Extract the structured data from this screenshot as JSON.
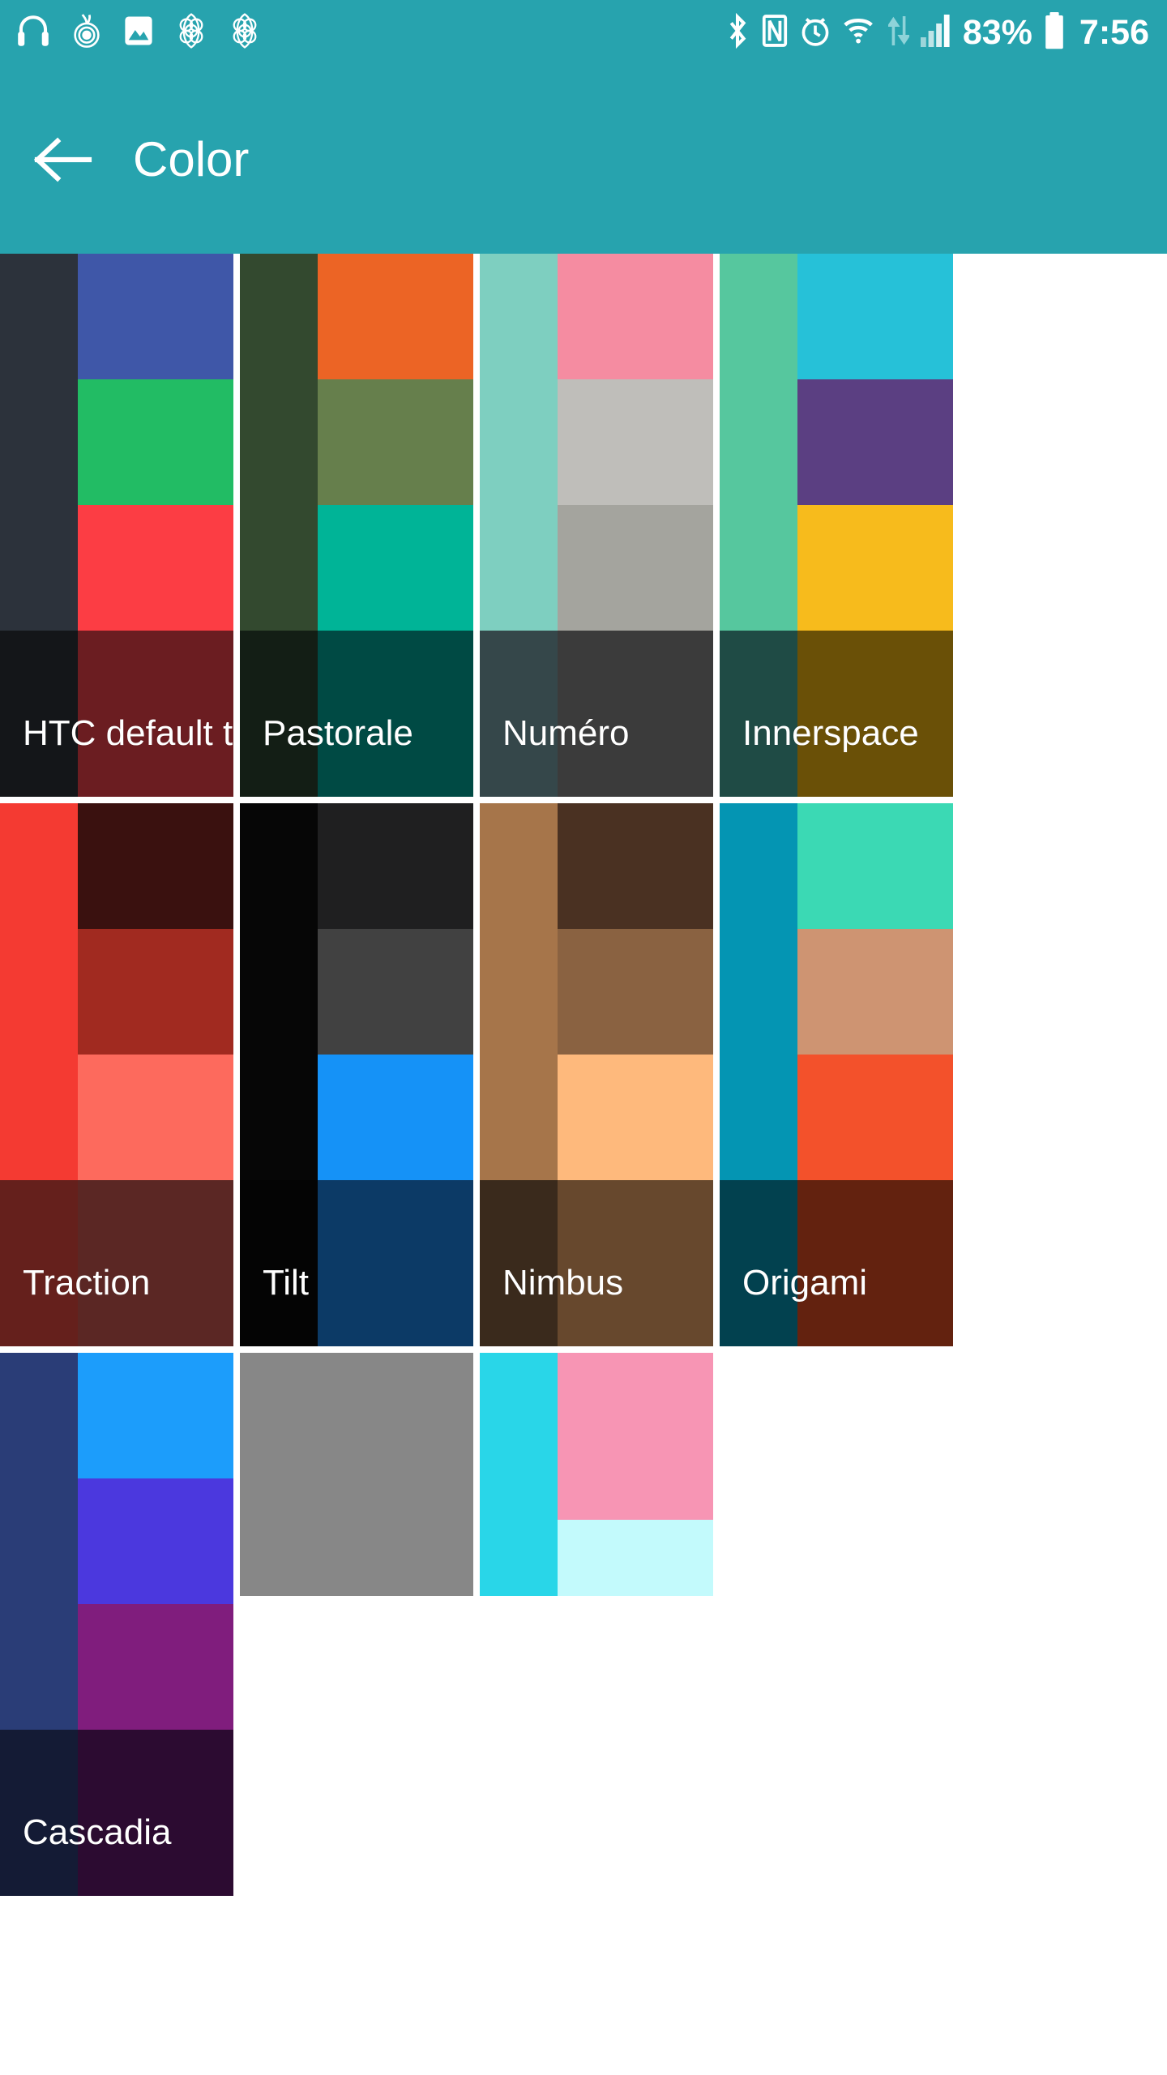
{
  "theme": {
    "accent": "#27A3AE"
  },
  "statusbar": {
    "icons_left": [
      "headphones-icon",
      "onion-router-icon",
      "gallery-image-icon",
      "flower-sync-icon",
      "flower-sync-icon-2"
    ],
    "icons_right": [
      "bluetooth-icon",
      "nfc-icon",
      "alarm-clock-icon",
      "wifi-icon",
      "data-transfer-icon",
      "signal-bars-icon"
    ],
    "battery_percent": "83%",
    "battery_icon": "battery-icon",
    "time": "7:56"
  },
  "appbar": {
    "back_icon": "back-arrow-icon",
    "title": "Color"
  },
  "themes": [
    {
      "name": "HTC default t...",
      "left": "#2C323B",
      "bands": [
        "#3F57A8",
        "#22BC64",
        "#FC3D44"
      ],
      "label_left": "#141619",
      "label_right": "#6B1D21"
    },
    {
      "name": "Pastorale",
      "left": "#33492F",
      "bands": [
        "#EC6425",
        "#667F4C",
        "#00B497"
      ],
      "label_left": "#131E15",
      "label_right": "#004A44"
    },
    {
      "name": "Numéro",
      "left": "#7ECFC0",
      "bands": [
        "#F58CA1",
        "#BFBEBA",
        "#A4A49E"
      ],
      "label_left": "#35474A",
      "label_right": "#3B3B3B"
    },
    {
      "name": "Innerspace",
      "left": "#56C79E",
      "bands": [
        "#26C1D8",
        "#5B3F82",
        "#F7BB1C"
      ],
      "label_left": "#1F4B45",
      "label_right": "#6A5007"
    },
    {
      "name": "Traction",
      "left": "#F43A32",
      "bands": [
        "#3A110F",
        "#A12A20",
        "#FD6A5D"
      ],
      "label_left": "#65201C",
      "label_right": "#5B2724"
    },
    {
      "name": "Tilt",
      "left": "#060606",
      "bands": [
        "#1F1F20",
        "#414141",
        "#1592F7"
      ],
      "label_left": "#040404",
      "label_right": "#0C3A66"
    },
    {
      "name": "Nimbus",
      "left": "#A6754A",
      "bands": [
        "#4A3122",
        "#8A6241",
        "#FEB97C"
      ],
      "label_left": "#3A2A1C",
      "label_right": "#67482D"
    },
    {
      "name": "Origami",
      "left": "#0495B3",
      "bands": [
        "#3BD9B4",
        "#CE9472",
        "#F3512B"
      ],
      "label_left": "#02414F",
      "label_right": "#63220F"
    },
    {
      "name": "Cascadia",
      "left": "#2A3D77",
      "bands": [
        "#1C9DFB",
        "#4B38DE",
        "#801D7D"
      ],
      "label_left": "#141B35",
      "label_right": "#2C0B31"
    },
    {
      "name": "",
      "left": "#878787",
      "bands": [
        "#878787",
        "#878787",
        "#878787"
      ],
      "label_left": "#878787",
      "label_right": "#878787"
    },
    {
      "name": "",
      "left": "#29D6E8",
      "bands": [
        "#F795B4",
        "#F795B4",
        "#C3FAFC"
      ],
      "label_left": "#29D6E8",
      "label_right": "#C3FAFC"
    }
  ]
}
